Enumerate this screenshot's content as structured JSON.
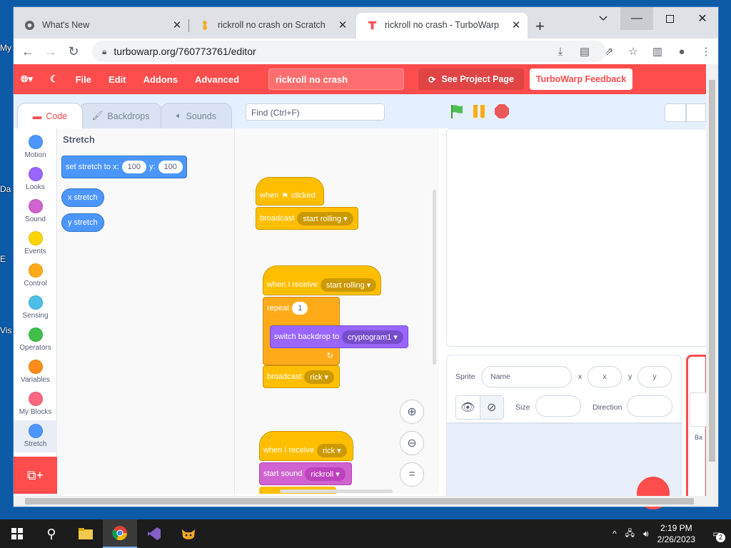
{
  "desktop": {
    "labels": [
      "My",
      "Da",
      "E",
      "Vis"
    ]
  },
  "browser": {
    "tabs": [
      {
        "title": "What's New",
        "icon": "chrome-icon"
      },
      {
        "title": "rickroll no crash on Scratch",
        "icon": "scratch-icon"
      },
      {
        "title": "rickroll no crash - TurboWarp",
        "icon": "turbowarp-icon"
      }
    ],
    "url": "turbowarp.org/760773761/editor"
  },
  "menu": {
    "file": "File",
    "edit": "Edit",
    "addons": "Addons",
    "advanced": "Advanced",
    "project_title": "rickroll no crash",
    "see_project": "See Project Page",
    "feedback": "TurboWarp Feedback"
  },
  "editor_tabs": {
    "code": "Code",
    "backdrops": "Backdrops",
    "sounds": "Sounds",
    "find_placeholder": "Find (Ctrl+F)"
  },
  "categories": [
    {
      "label": "Motion",
      "color": "#4c97ff"
    },
    {
      "label": "Looks",
      "color": "#9966ff"
    },
    {
      "label": "Sound",
      "color": "#cf63cf"
    },
    {
      "label": "Events",
      "color": "#ffd500"
    },
    {
      "label": "Control",
      "color": "#ffab19"
    },
    {
      "label": "Sensing",
      "color": "#4cbfe6"
    },
    {
      "label": "Operators",
      "color": "#40bf4a"
    },
    {
      "label": "Variables",
      "color": "#ff8c1a"
    },
    {
      "label": "My Blocks",
      "color": "#ff6680"
    },
    {
      "label": "Stretch",
      "color": "#4c97ff"
    }
  ],
  "flyout": {
    "heading": "Stretch",
    "set_stretch": "set stretch to x:",
    "x_val": "100",
    "y_label": "y:",
    "y_val": "100",
    "x_stretch": "x stretch",
    "y_stretch": "y stretch"
  },
  "scripts": {
    "when": "when",
    "clicked": "clicked",
    "broadcast": "broadcast",
    "start_rolling": "start rolling",
    "when_receive": "when I receive",
    "repeat": "repeat",
    "repeat_count": "1",
    "switch_backdrop": "switch backdrop to",
    "backdrop": "cryptogram1",
    "rick": "rick",
    "start_sound": "start sound",
    "rickroll": "rickroll"
  },
  "sprite": {
    "sprite_label": "Sprite",
    "name_ph": "Name",
    "x_label": "x",
    "x_ph": "x",
    "y_label": "y",
    "y_ph": "y",
    "size_label": "Size",
    "direction_label": "Direction",
    "stage_stub": "Ba"
  },
  "clock": {
    "time": "2:19 PM",
    "date": "2/26/2023"
  },
  "notifications": "2"
}
